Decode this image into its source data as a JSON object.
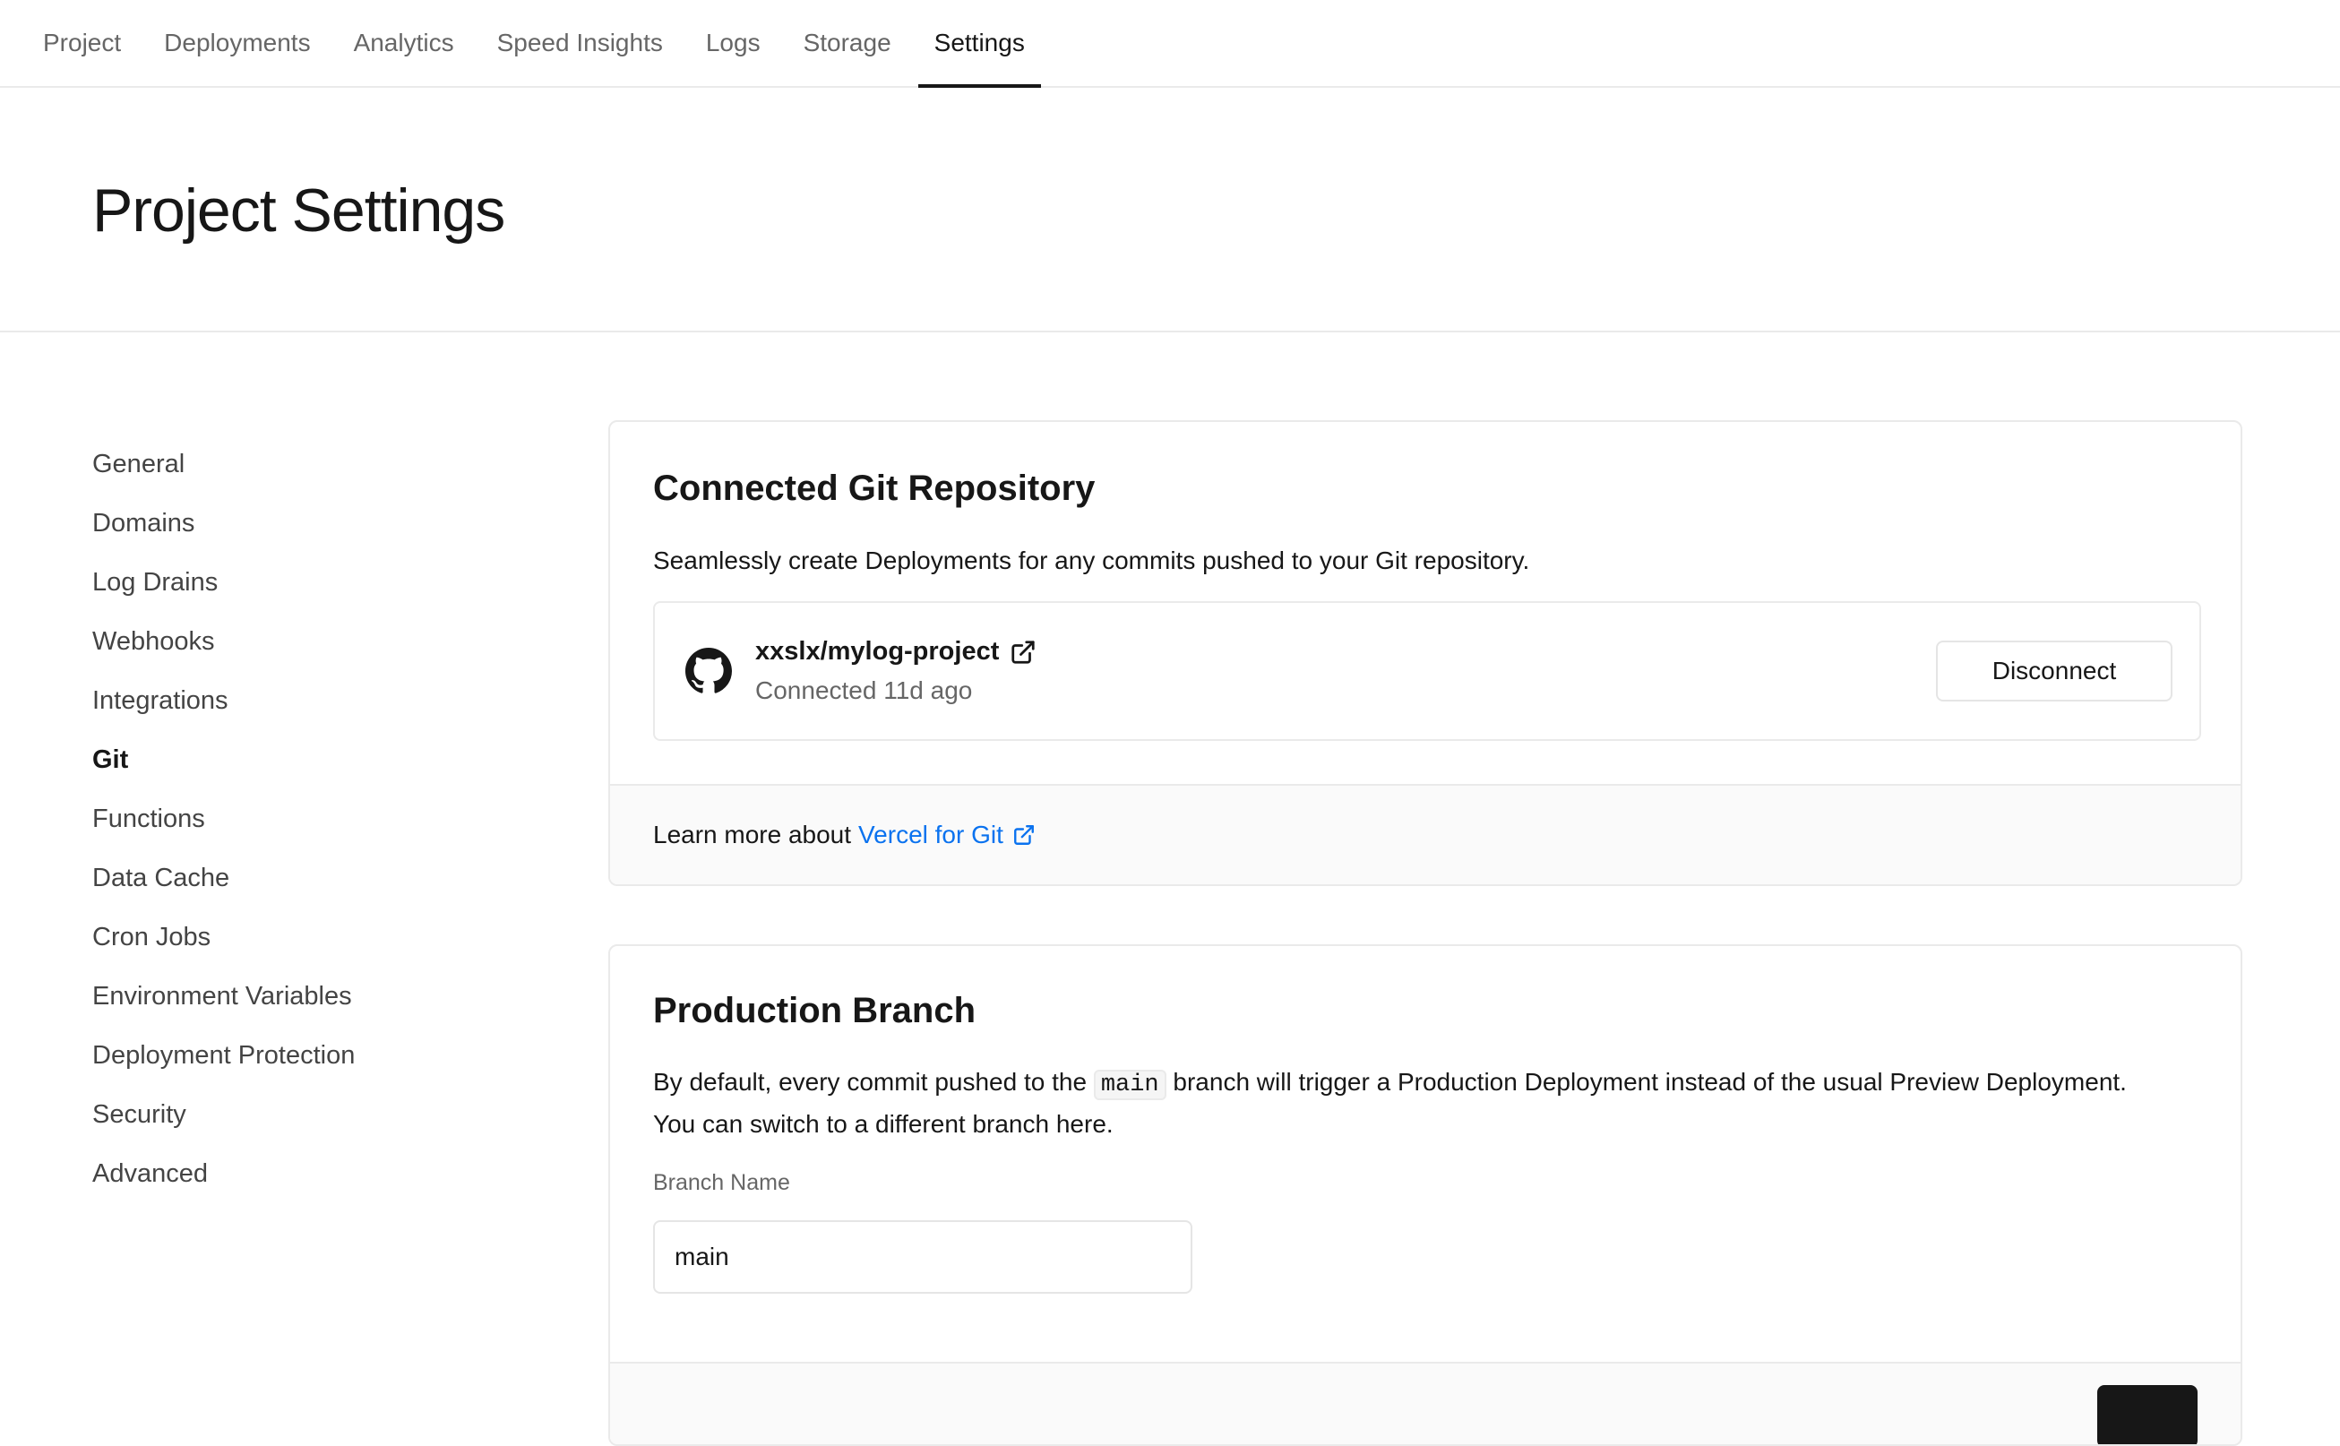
{
  "topnav": {
    "tabs": [
      {
        "label": "Project"
      },
      {
        "label": "Deployments"
      },
      {
        "label": "Analytics"
      },
      {
        "label": "Speed Insights"
      },
      {
        "label": "Logs"
      },
      {
        "label": "Storage"
      },
      {
        "label": "Settings",
        "active": true
      }
    ]
  },
  "header": {
    "title": "Project Settings"
  },
  "sidebar": {
    "items": [
      {
        "label": "General"
      },
      {
        "label": "Domains"
      },
      {
        "label": "Log Drains"
      },
      {
        "label": "Webhooks"
      },
      {
        "label": "Integrations"
      },
      {
        "label": "Git",
        "active": true
      },
      {
        "label": "Functions"
      },
      {
        "label": "Data Cache"
      },
      {
        "label": "Cron Jobs"
      },
      {
        "label": "Environment Variables"
      },
      {
        "label": "Deployment Protection"
      },
      {
        "label": "Security"
      },
      {
        "label": "Advanced"
      }
    ]
  },
  "git_card": {
    "title": "Connected Git Repository",
    "description": "Seamlessly create Deployments for any commits pushed to your Git repository.",
    "repo_name": "xxslx/mylog-project",
    "repo_status": "Connected 11d ago",
    "disconnect_label": "Disconnect",
    "footer_text": "Learn more about",
    "footer_link": "Vercel for Git"
  },
  "branch_card": {
    "title": "Production Branch",
    "desc_part1": "By default, every commit pushed to the",
    "desc_code": "main",
    "desc_part2": "branch will trigger a Production Deployment instead of the usual Preview Deployment. You can switch to a different branch here.",
    "field_label": "Branch Name",
    "field_value": "main"
  },
  "colors": {
    "accent_link": "#0a72ef",
    "text_primary": "#171717",
    "text_secondary": "#666666",
    "border": "#eaeaea"
  }
}
